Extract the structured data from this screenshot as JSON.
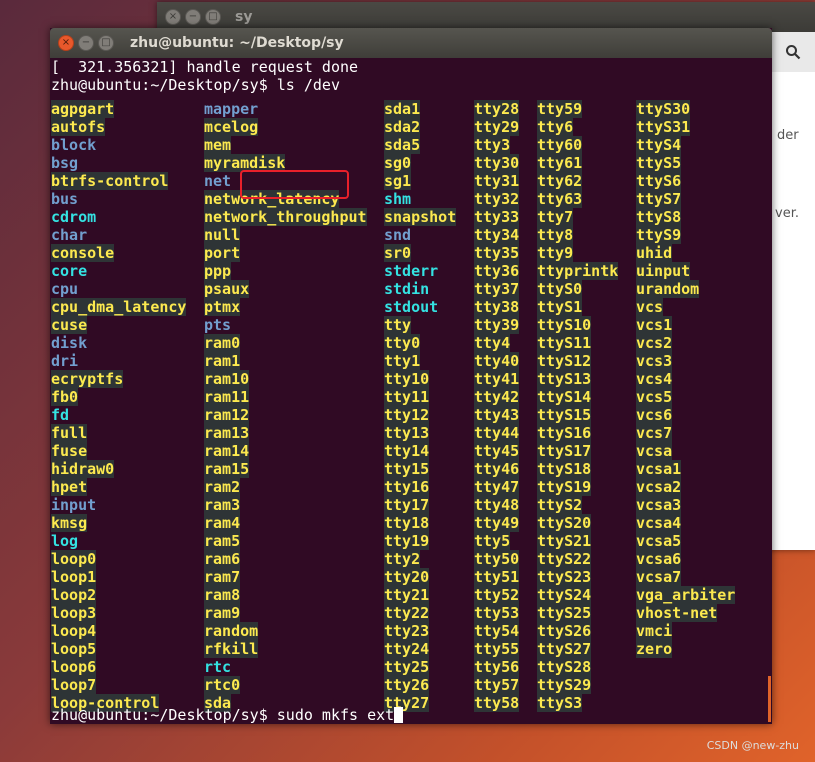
{
  "background_window": {
    "title": "sy",
    "buttons": [
      "×",
      "−",
      "□"
    ],
    "partial_text": [
      "der",
      "ver."
    ]
  },
  "terminal": {
    "title": "zhu@ubuntu: ~/Desktop/sy",
    "buttons": [
      "×",
      "−",
      "□"
    ],
    "line1": "[  321.356321] handle request done",
    "line2": "zhu@ubuntu:~/Desktop/sy$ ls /dev",
    "prompt": "zhu@ubuntu:~/Desktop/sy$ sudo mkfs ext",
    "columns": [
      [
        {
          "n": "agpgart",
          "t": "dev"
        },
        {
          "n": "autofs",
          "t": "dev"
        },
        {
          "n": "block",
          "t": "dir"
        },
        {
          "n": "bsg",
          "t": "dir"
        },
        {
          "n": "btrfs-control",
          "t": "dev"
        },
        {
          "n": "bus",
          "t": "dir"
        },
        {
          "n": "cdrom",
          "t": "link"
        },
        {
          "n": "char",
          "t": "dir"
        },
        {
          "n": "console",
          "t": "dev"
        },
        {
          "n": "core",
          "t": "link"
        },
        {
          "n": "cpu",
          "t": "dir"
        },
        {
          "n": "cpu_dma_latency",
          "t": "dev"
        },
        {
          "n": "cuse",
          "t": "dev"
        },
        {
          "n": "disk",
          "t": "dir"
        },
        {
          "n": "dri",
          "t": "dir"
        },
        {
          "n": "ecryptfs",
          "t": "dev"
        },
        {
          "n": "fb0",
          "t": "dev"
        },
        {
          "n": "fd",
          "t": "link"
        },
        {
          "n": "full",
          "t": "dev"
        },
        {
          "n": "fuse",
          "t": "dev"
        },
        {
          "n": "hidraw0",
          "t": "dev"
        },
        {
          "n": "hpet",
          "t": "dev"
        },
        {
          "n": "input",
          "t": "dir"
        },
        {
          "n": "kmsg",
          "t": "dev"
        },
        {
          "n": "log",
          "t": "link"
        },
        {
          "n": "loop0",
          "t": "dev"
        },
        {
          "n": "loop1",
          "t": "dev"
        },
        {
          "n": "loop2",
          "t": "dev"
        },
        {
          "n": "loop3",
          "t": "dev"
        },
        {
          "n": "loop4",
          "t": "dev"
        },
        {
          "n": "loop5",
          "t": "dev"
        },
        {
          "n": "loop6",
          "t": "dev"
        },
        {
          "n": "loop7",
          "t": "dev"
        },
        {
          "n": "loop-control",
          "t": "dev"
        }
      ],
      [
        {
          "n": "mapper",
          "t": "dir"
        },
        {
          "n": "mcelog",
          "t": "dev"
        },
        {
          "n": "mem",
          "t": "dev"
        },
        {
          "n": "myramdisk",
          "t": "dev"
        },
        {
          "n": "net",
          "t": "dir"
        },
        {
          "n": "network_latency",
          "t": "dev"
        },
        {
          "n": "network_throughput",
          "t": "dev"
        },
        {
          "n": "null",
          "t": "dev"
        },
        {
          "n": "port",
          "t": "dev"
        },
        {
          "n": "ppp",
          "t": "dev"
        },
        {
          "n": "psaux",
          "t": "dev"
        },
        {
          "n": "ptmx",
          "t": "dev"
        },
        {
          "n": "pts",
          "t": "dir"
        },
        {
          "n": "ram0",
          "t": "dev"
        },
        {
          "n": "ram1",
          "t": "dev"
        },
        {
          "n": "ram10",
          "t": "dev"
        },
        {
          "n": "ram11",
          "t": "dev"
        },
        {
          "n": "ram12",
          "t": "dev"
        },
        {
          "n": "ram13",
          "t": "dev"
        },
        {
          "n": "ram14",
          "t": "dev"
        },
        {
          "n": "ram15",
          "t": "dev"
        },
        {
          "n": "ram2",
          "t": "dev"
        },
        {
          "n": "ram3",
          "t": "dev"
        },
        {
          "n": "ram4",
          "t": "dev"
        },
        {
          "n": "ram5",
          "t": "dev"
        },
        {
          "n": "ram6",
          "t": "dev"
        },
        {
          "n": "ram7",
          "t": "dev"
        },
        {
          "n": "ram8",
          "t": "dev"
        },
        {
          "n": "ram9",
          "t": "dev"
        },
        {
          "n": "random",
          "t": "dev"
        },
        {
          "n": "rfkill",
          "t": "dev"
        },
        {
          "n": "rtc",
          "t": "link"
        },
        {
          "n": "rtc0",
          "t": "dev"
        },
        {
          "n": "sda",
          "t": "dev"
        }
      ],
      [
        {
          "n": "sda1",
          "t": "dev"
        },
        {
          "n": "sda2",
          "t": "dev"
        },
        {
          "n": "sda5",
          "t": "dev"
        },
        {
          "n": "sg0",
          "t": "dev"
        },
        {
          "n": "sg1",
          "t": "dev"
        },
        {
          "n": "shm",
          "t": "link"
        },
        {
          "n": "snapshot",
          "t": "dev"
        },
        {
          "n": "snd",
          "t": "dir"
        },
        {
          "n": "sr0",
          "t": "dev"
        },
        {
          "n": "stderr",
          "t": "link"
        },
        {
          "n": "stdin",
          "t": "link"
        },
        {
          "n": "stdout",
          "t": "link"
        },
        {
          "n": "tty",
          "t": "dev"
        },
        {
          "n": "tty0",
          "t": "dev"
        },
        {
          "n": "tty1",
          "t": "dev"
        },
        {
          "n": "tty10",
          "t": "dev"
        },
        {
          "n": "tty11",
          "t": "dev"
        },
        {
          "n": "tty12",
          "t": "dev"
        },
        {
          "n": "tty13",
          "t": "dev"
        },
        {
          "n": "tty14",
          "t": "dev"
        },
        {
          "n": "tty15",
          "t": "dev"
        },
        {
          "n": "tty16",
          "t": "dev"
        },
        {
          "n": "tty17",
          "t": "dev"
        },
        {
          "n": "tty18",
          "t": "dev"
        },
        {
          "n": "tty19",
          "t": "dev"
        },
        {
          "n": "tty2",
          "t": "dev"
        },
        {
          "n": "tty20",
          "t": "dev"
        },
        {
          "n": "tty21",
          "t": "dev"
        },
        {
          "n": "tty22",
          "t": "dev"
        },
        {
          "n": "tty23",
          "t": "dev"
        },
        {
          "n": "tty24",
          "t": "dev"
        },
        {
          "n": "tty25",
          "t": "dev"
        },
        {
          "n": "tty26",
          "t": "dev"
        },
        {
          "n": "tty27",
          "t": "dev"
        }
      ],
      [
        {
          "n": "tty28",
          "t": "dev"
        },
        {
          "n": "tty29",
          "t": "dev"
        },
        {
          "n": "tty3",
          "t": "dev"
        },
        {
          "n": "tty30",
          "t": "dev"
        },
        {
          "n": "tty31",
          "t": "dev"
        },
        {
          "n": "tty32",
          "t": "dev"
        },
        {
          "n": "tty33",
          "t": "dev"
        },
        {
          "n": "tty34",
          "t": "dev"
        },
        {
          "n": "tty35",
          "t": "dev"
        },
        {
          "n": "tty36",
          "t": "dev"
        },
        {
          "n": "tty37",
          "t": "dev"
        },
        {
          "n": "tty38",
          "t": "dev"
        },
        {
          "n": "tty39",
          "t": "dev"
        },
        {
          "n": "tty4",
          "t": "dev"
        },
        {
          "n": "tty40",
          "t": "dev"
        },
        {
          "n": "tty41",
          "t": "dev"
        },
        {
          "n": "tty42",
          "t": "dev"
        },
        {
          "n": "tty43",
          "t": "dev"
        },
        {
          "n": "tty44",
          "t": "dev"
        },
        {
          "n": "tty45",
          "t": "dev"
        },
        {
          "n": "tty46",
          "t": "dev"
        },
        {
          "n": "tty47",
          "t": "dev"
        },
        {
          "n": "tty48",
          "t": "dev"
        },
        {
          "n": "tty49",
          "t": "dev"
        },
        {
          "n": "tty5",
          "t": "dev"
        },
        {
          "n": "tty50",
          "t": "dev"
        },
        {
          "n": "tty51",
          "t": "dev"
        },
        {
          "n": "tty52",
          "t": "dev"
        },
        {
          "n": "tty53",
          "t": "dev"
        },
        {
          "n": "tty54",
          "t": "dev"
        },
        {
          "n": "tty55",
          "t": "dev"
        },
        {
          "n": "tty56",
          "t": "dev"
        },
        {
          "n": "tty57",
          "t": "dev"
        },
        {
          "n": "tty58",
          "t": "dev"
        }
      ],
      [
        {
          "n": "tty59",
          "t": "dev"
        },
        {
          "n": "tty6",
          "t": "dev"
        },
        {
          "n": "tty60",
          "t": "dev"
        },
        {
          "n": "tty61",
          "t": "dev"
        },
        {
          "n": "tty62",
          "t": "dev"
        },
        {
          "n": "tty63",
          "t": "dev"
        },
        {
          "n": "tty7",
          "t": "dev"
        },
        {
          "n": "tty8",
          "t": "dev"
        },
        {
          "n": "tty9",
          "t": "dev"
        },
        {
          "n": "ttyprintk",
          "t": "dev"
        },
        {
          "n": "ttyS0",
          "t": "dev"
        },
        {
          "n": "ttyS1",
          "t": "dev"
        },
        {
          "n": "ttyS10",
          "t": "dev"
        },
        {
          "n": "ttyS11",
          "t": "dev"
        },
        {
          "n": "ttyS12",
          "t": "dev"
        },
        {
          "n": "ttyS13",
          "t": "dev"
        },
        {
          "n": "ttyS14",
          "t": "dev"
        },
        {
          "n": "ttyS15",
          "t": "dev"
        },
        {
          "n": "ttyS16",
          "t": "dev"
        },
        {
          "n": "ttyS17",
          "t": "dev"
        },
        {
          "n": "ttyS18",
          "t": "dev"
        },
        {
          "n": "ttyS19",
          "t": "dev"
        },
        {
          "n": "ttyS2",
          "t": "dev"
        },
        {
          "n": "ttyS20",
          "t": "dev"
        },
        {
          "n": "ttyS21",
          "t": "dev"
        },
        {
          "n": "ttyS22",
          "t": "dev"
        },
        {
          "n": "ttyS23",
          "t": "dev"
        },
        {
          "n": "ttyS24",
          "t": "dev"
        },
        {
          "n": "ttyS25",
          "t": "dev"
        },
        {
          "n": "ttyS26",
          "t": "dev"
        },
        {
          "n": "ttyS27",
          "t": "dev"
        },
        {
          "n": "ttyS28",
          "t": "dev"
        },
        {
          "n": "ttyS29",
          "t": "dev"
        },
        {
          "n": "ttyS3",
          "t": "dev"
        }
      ],
      [
        {
          "n": "ttyS30",
          "t": "dev"
        },
        {
          "n": "ttyS31",
          "t": "dev"
        },
        {
          "n": "ttyS4",
          "t": "dev"
        },
        {
          "n": "ttyS5",
          "t": "dev"
        },
        {
          "n": "ttyS6",
          "t": "dev"
        },
        {
          "n": "ttyS7",
          "t": "dev"
        },
        {
          "n": "ttyS8",
          "t": "dev"
        },
        {
          "n": "ttyS9",
          "t": "dev"
        },
        {
          "n": "uhid",
          "t": "dev"
        },
        {
          "n": "uinput",
          "t": "dev"
        },
        {
          "n": "urandom",
          "t": "dev"
        },
        {
          "n": "vcs",
          "t": "dev"
        },
        {
          "n": "vcs1",
          "t": "dev"
        },
        {
          "n": "vcs2",
          "t": "dev"
        },
        {
          "n": "vcs3",
          "t": "dev"
        },
        {
          "n": "vcs4",
          "t": "dev"
        },
        {
          "n": "vcs5",
          "t": "dev"
        },
        {
          "n": "vcs6",
          "t": "dev"
        },
        {
          "n": "vcs7",
          "t": "dev"
        },
        {
          "n": "vcsa",
          "t": "dev"
        },
        {
          "n": "vcsa1",
          "t": "dev"
        },
        {
          "n": "vcsa2",
          "t": "dev"
        },
        {
          "n": "vcsa3",
          "t": "dev"
        },
        {
          "n": "vcsa4",
          "t": "dev"
        },
        {
          "n": "vcsa5",
          "t": "dev"
        },
        {
          "n": "vcsa6",
          "t": "dev"
        },
        {
          "n": "vcsa7",
          "t": "dev"
        },
        {
          "n": "vga_arbiter",
          "t": "dev"
        },
        {
          "n": "vhost-net",
          "t": "dev"
        },
        {
          "n": "vmci",
          "t": "dev"
        },
        {
          "n": "zero",
          "t": "dev"
        }
      ]
    ]
  },
  "colors": {
    "terminal_bg": "#300a24",
    "dir": "#729fcf",
    "device": "#fce94f",
    "device_bg": "#2e3436",
    "link": "#34e2e2",
    "highlight_box": "#e8202a"
  },
  "watermark": "CSDN @new-zhu"
}
